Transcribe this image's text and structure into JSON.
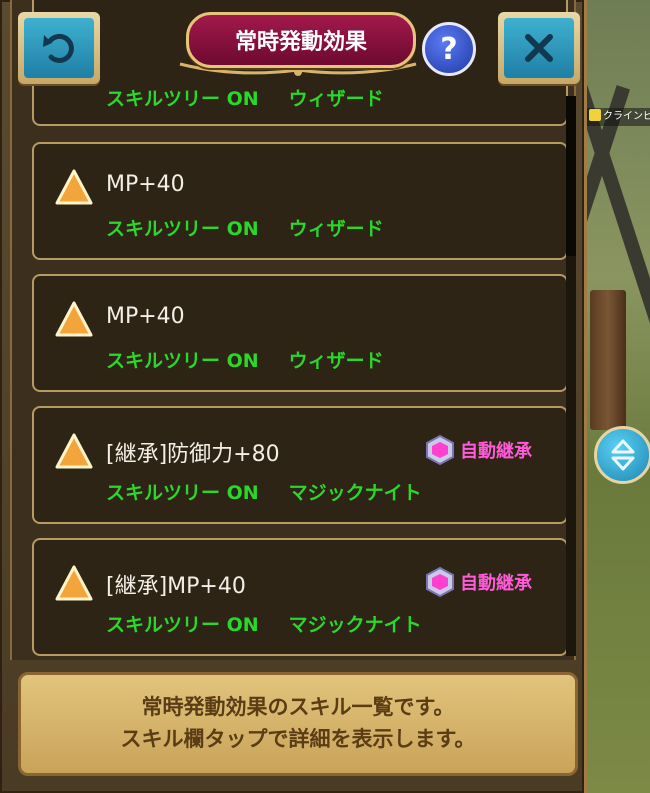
{
  "header": {
    "title": "常時発動効果",
    "help_label": "?",
    "back_icon": "back-arrow-icon",
    "close_icon": "close-icon"
  },
  "npc_label": "クラインビ",
  "skills": [
    {
      "name": "",
      "tree": "スキルツリー ON",
      "class": "ウィザード",
      "inherit": ""
    },
    {
      "name": "MP+40",
      "tree": "スキルツリー ON",
      "class": "ウィザード",
      "inherit": ""
    },
    {
      "name": "MP+40",
      "tree": "スキルツリー ON",
      "class": "ウィザード",
      "inherit": ""
    },
    {
      "name": "[継承]防御力+80",
      "tree": "スキルツリー ON",
      "class": "マジックナイト",
      "inherit": "自動継承"
    },
    {
      "name": "[継承]MP+40",
      "tree": "スキルツリー ON",
      "class": "マジックナイト",
      "inherit": "自動継承"
    }
  ],
  "footer": {
    "line1": "常時発動効果のスキル一覧です。",
    "line2": "スキル欄タップで詳細を表示します。"
  },
  "colors": {
    "accent_green": "#2ad72a",
    "inherit_pink": "#ff5bd8",
    "title_plate": "#8e1340"
  }
}
